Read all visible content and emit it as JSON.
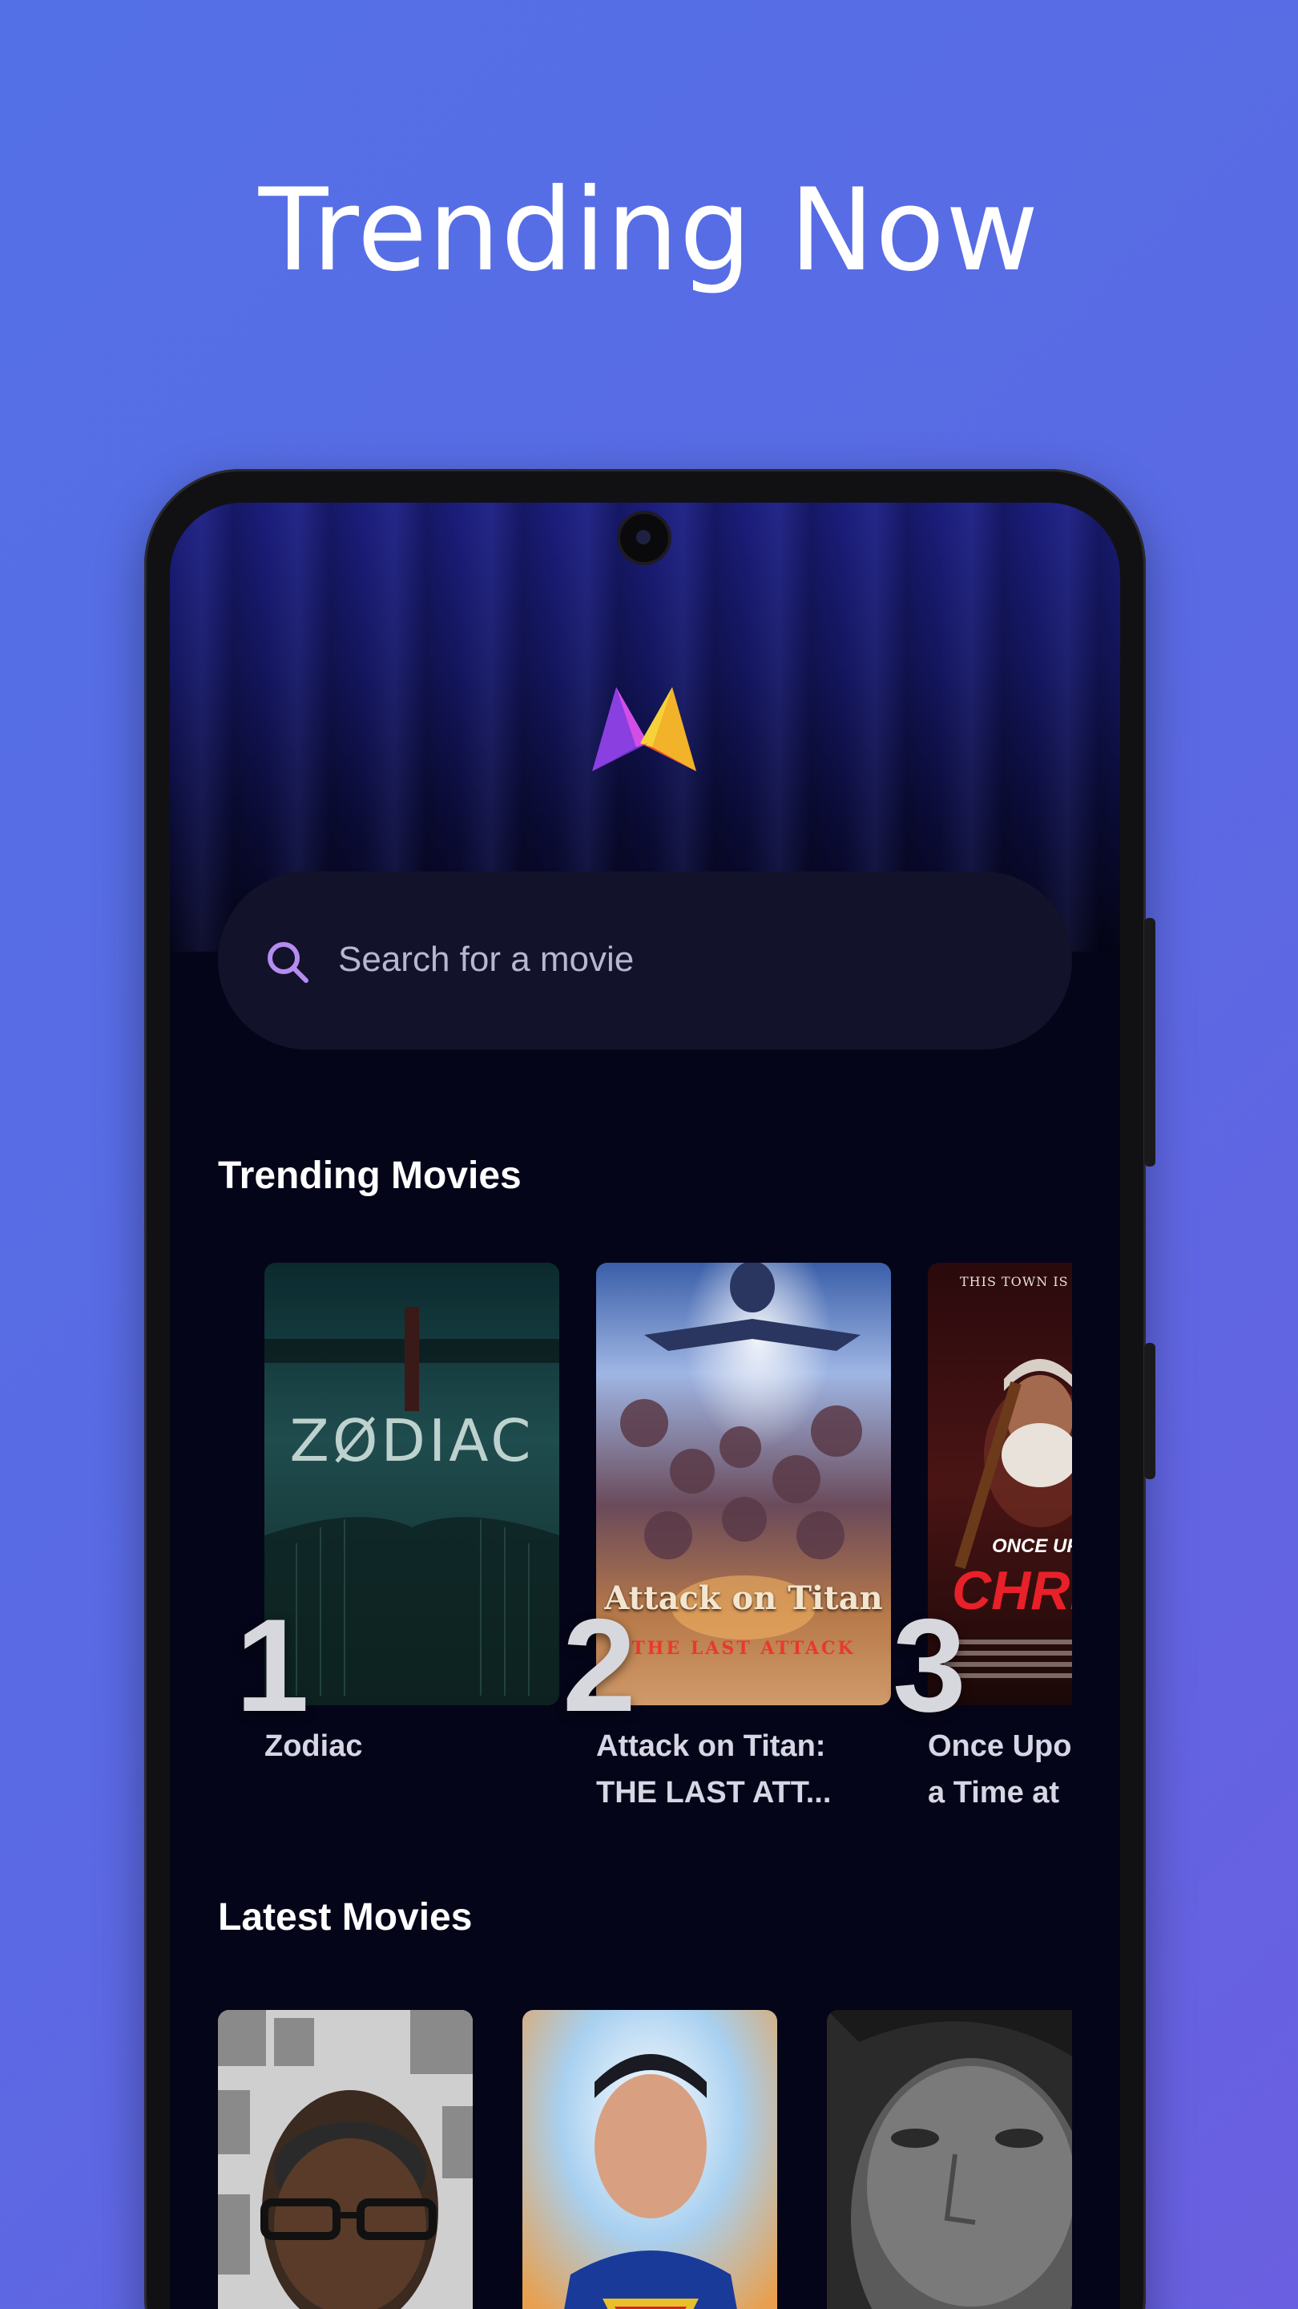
{
  "headline": "Trending Now",
  "app": {
    "logo_icon": "app-logo-icon",
    "search": {
      "placeholder": "Search for a movie",
      "icon": "search-icon"
    }
  },
  "trending": {
    "title": "Trending Movies",
    "items": [
      {
        "rank": "1",
        "title": "Zodiac",
        "poster_text": "ZØDIAC"
      },
      {
        "rank": "2",
        "title": "Attack on Titan:\nTHE LAST ATT...",
        "poster_text": "Attack on Titan",
        "poster_sub": "THE LAST ATTACK"
      },
      {
        "rank": "3",
        "title": "Once Upon\na Time at",
        "poster_text": "ONCE UPON",
        "poster_sub": "CHRI",
        "poster_tagline": "THIS TOWN IS DYI"
      }
    ]
  },
  "latest": {
    "title": "Latest Movies",
    "items": [
      {
        "name": "latest-poster-1"
      },
      {
        "name": "latest-poster-2"
      },
      {
        "name": "latest-poster-3"
      }
    ]
  },
  "colors": {
    "background": "#5a6ae4",
    "screen": "#050519",
    "search_bg": "#12122a",
    "accent_purple": "#b58cf0"
  }
}
